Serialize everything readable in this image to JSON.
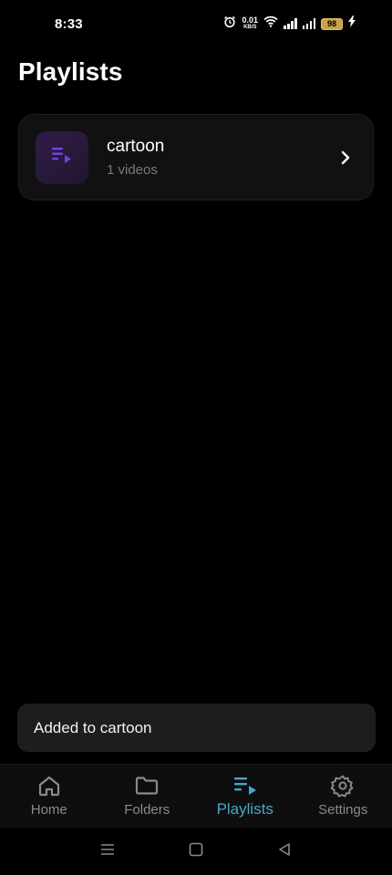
{
  "status_bar": {
    "time": "8:33",
    "net_speed_value": "0.01",
    "net_speed_unit": "KB/S",
    "battery": "98"
  },
  "page": {
    "title": "Playlists"
  },
  "playlists": [
    {
      "name": "cartoon",
      "count": "1 videos"
    }
  ],
  "snackbar": {
    "message": "Added to cartoon"
  },
  "bottom_nav": {
    "items": [
      {
        "label": "Home",
        "icon": "home-icon",
        "active": false
      },
      {
        "label": "Folders",
        "icon": "folder-icon",
        "active": false
      },
      {
        "label": "Playlists",
        "icon": "playlist-icon",
        "active": true
      },
      {
        "label": "Settings",
        "icon": "gear-icon",
        "active": false
      }
    ]
  },
  "colors": {
    "accent": "#47a7c9",
    "playlist_icon": "#7b3fe4",
    "background": "#000000",
    "card": "#111113"
  }
}
